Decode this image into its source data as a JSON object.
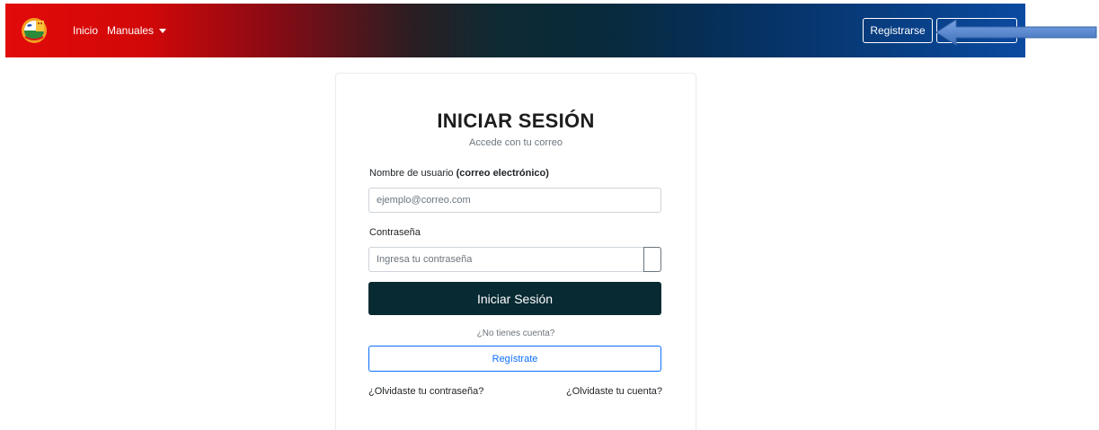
{
  "navbar": {
    "links": [
      {
        "label": "Inicio"
      },
      {
        "label": "Manuales"
      }
    ],
    "register_label": "Registrarse",
    "second_label": "",
    "logo_icon": "school-logo-icon"
  },
  "login": {
    "title": "INICIAR SESIÓN",
    "subtitle": "Accede con tu correo",
    "username_label": "Nombre de usuario ",
    "username_label_bold": "(correo electrónico)",
    "username_placeholder": "ejemplo@correo.com",
    "password_label": "Contraseña",
    "password_placeholder": "Ingresa tu contraseña",
    "submit_label": "Iniciar Sesión",
    "no_account_text": "¿No tienes cuenta?",
    "register_label": "Regístrate",
    "forgot_password": "¿Olvidaste tu contraseña?",
    "forgot_account": "¿Olvidaste tu cuenta?"
  },
  "colors": {
    "primary_dark": "#082a33",
    "link_blue": "#0d6efd",
    "arrow_blue": "#5b8ed6"
  }
}
